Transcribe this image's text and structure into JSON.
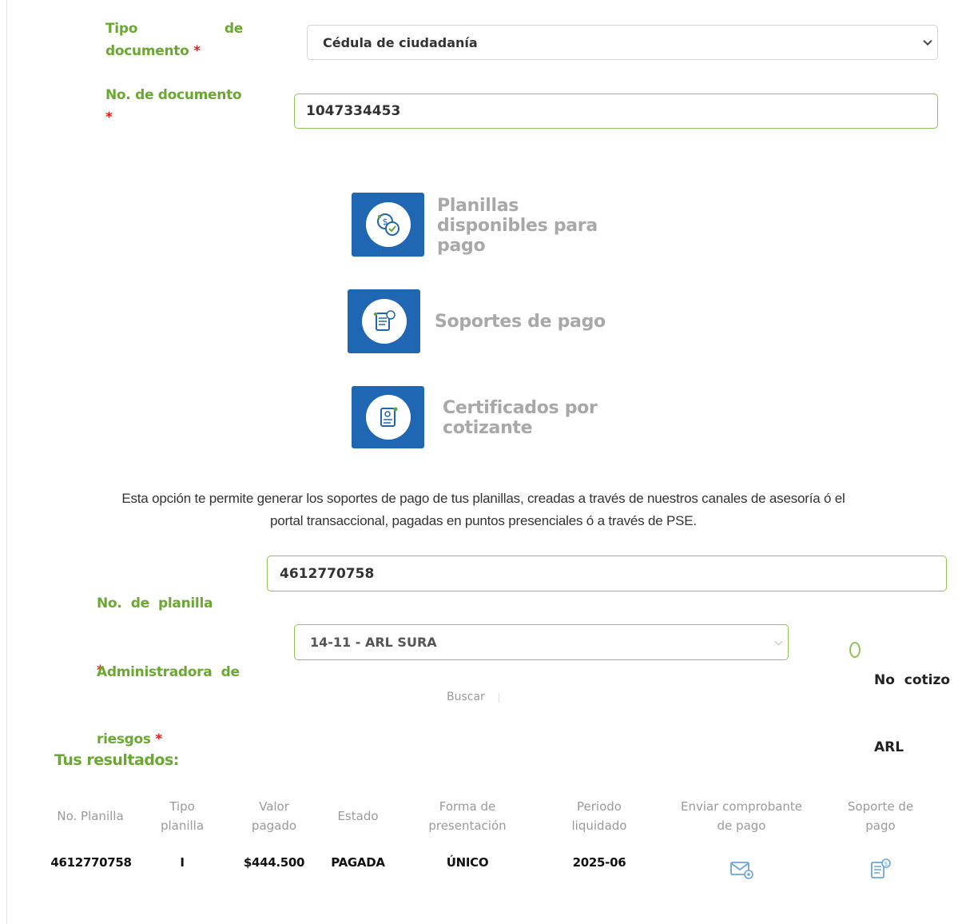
{
  "form": {
    "doc_type": {
      "label_word1": "Tipo",
      "label_word2": "de",
      "label_line2": "documento",
      "required_mark": "*",
      "value": "Cédula de ciudadanía"
    },
    "doc_number": {
      "label": "No. de documento",
      "required_mark": "*",
      "value": "1047334453"
    }
  },
  "options": [
    {
      "icon": "coins-check-icon",
      "lines": [
        "Planillas",
        "disponibles para",
        "pago"
      ]
    },
    {
      "icon": "payment-receipt-icon",
      "lines": [
        "Soportes de pago"
      ]
    },
    {
      "icon": "certificate-icon",
      "lines": [
        "Certificados por",
        "cotizante"
      ]
    }
  ],
  "description": {
    "line1": "Esta opción te permite generar los soportes de pago de tus planillas, creadas a través de nuestros canales de asesoría ó el",
    "line2": "portal transaccional, pagadas en puntos presenciales ó a través de PSE."
  },
  "search": {
    "planilla": {
      "label": "No.  de  planilla",
      "required_mark": "*",
      "value": "4612770758"
    },
    "arl": {
      "label_line1": "Administradora  de",
      "label_line2": "riesgos",
      "required_mark": "*",
      "value": "14-11 - ARL SURA"
    },
    "no_arl": {
      "line1": "No  cotizo",
      "line2": "ARL"
    },
    "buscar_label": "Buscar"
  },
  "results": {
    "title": "Tus resultados:",
    "headers": [
      [
        "No. Planilla"
      ],
      [
        "Tipo",
        "planilla"
      ],
      [
        "Valor",
        "pagado"
      ],
      [
        "Estado"
      ],
      [
        "Forma de",
        "presentación"
      ],
      [
        "Periodo",
        "liquidado"
      ],
      [
        "Enviar comprobante",
        "de pago"
      ],
      [
        "Soporte de",
        "pago"
      ]
    ],
    "row": {
      "planilla": "4612770758",
      "tipo": "I",
      "valor": "$444.500",
      "estado": "PAGADA",
      "forma": "ÚNICO",
      "periodo": "2025-06"
    }
  },
  "colors": {
    "accent_green": "#6aa832",
    "tile_blue": "#1f66b3",
    "required_red": "#e02020"
  }
}
